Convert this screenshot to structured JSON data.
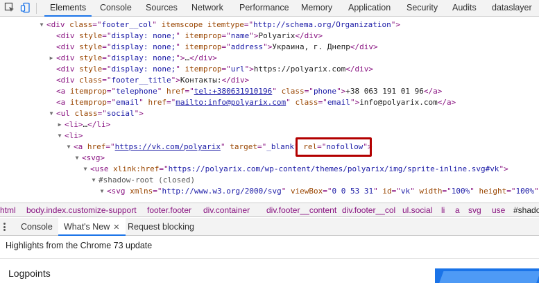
{
  "tabs": [
    "Elements",
    "Console",
    "Sources",
    "Network",
    "Performance",
    "Memory",
    "Application",
    "Security",
    "Audits",
    "dataslayer"
  ],
  "lines": [
    {
      "t": "open",
      "tag": "div",
      "attrs": [
        [
          "class",
          "footer__col"
        ],
        [
          "itemscope",
          null
        ],
        [
          "itemtype",
          "http://schema.org/Organization"
        ]
      ]
    },
    {
      "t": "div",
      "attrs": [
        [
          "style",
          "display: none;"
        ],
        [
          "itemprop",
          "name"
        ]
      ],
      "text": "Polyarix"
    },
    {
      "t": "div",
      "attrs": [
        [
          "style",
          "display: none;"
        ],
        [
          "itemprop",
          "address"
        ]
      ],
      "text": "Украина, г. Днепр"
    },
    {
      "t": "div",
      "attrs": [
        [
          "style",
          "display: none;"
        ]
      ],
      "text": "…"
    },
    {
      "t": "div",
      "attrs": [
        [
          "style",
          "display: none;"
        ],
        [
          "itemprop",
          "url"
        ]
      ],
      "text": "https://polyarix.com"
    },
    {
      "t": "div",
      "attrs": [
        [
          "class",
          "footer__title"
        ]
      ],
      "text": "Контакты:"
    },
    {
      "t": "a",
      "attrs": [
        [
          "itemprop",
          "telephone"
        ],
        [
          "href",
          "tel:+380631910196"
        ],
        [
          "class",
          "phone"
        ]
      ],
      "text": "+38 063 191 01 96"
    },
    {
      "t": "a",
      "attrs": [
        [
          "itemprop",
          "email"
        ],
        [
          "href",
          "mailto:info@polyarix.com"
        ],
        [
          "class",
          "email"
        ]
      ],
      "text": "info@polyarix.com"
    },
    {
      "t": "open",
      "tag": "ul",
      "attrs": [
        [
          "class",
          "social"
        ]
      ]
    },
    {
      "t": "li",
      "attrs": [],
      "text": "…"
    },
    {
      "t": "open",
      "tag": "li",
      "attrs": []
    },
    {
      "t": "open",
      "tag": "a",
      "attrs": [
        [
          "href",
          "https://vk.com/polyarix"
        ],
        [
          "target",
          "_blank"
        ],
        [
          "rel",
          "nofollow"
        ]
      ]
    },
    {
      "t": "open",
      "tag": "svg",
      "attrs": []
    },
    {
      "t": "open",
      "tag": "use",
      "attrs": [
        [
          "xlink:href",
          "https://polyarix.com/wp-content/themes/polyarix/img/sprite-inline.svg#vk"
        ]
      ]
    },
    {
      "t": "shadow",
      "text": "#shadow-root (closed)"
    },
    {
      "t": "open",
      "tag": "svg",
      "attrs": [
        [
          "xmlns",
          "http://www.w3.org/2000/svg"
        ],
        [
          "viewBox",
          "0 0 53 31"
        ],
        [
          "id",
          "vk"
        ],
        [
          "width",
          "100%"
        ],
        [
          "height",
          "100%"
        ]
      ]
    }
  ],
  "breadcrumbs": [
    "html",
    "body.index.customize-support",
    "footer.footer",
    "div.container",
    "div.footer__content",
    "div.footer__col",
    "ul.social",
    "li",
    "a",
    "svg",
    "use",
    "#shadow-root"
  ],
  "drawer_tabs": [
    "Console",
    "What's New",
    "Request blocking"
  ],
  "drawer_close": "✕",
  "headline": "Highlights from the Chrome 73 update",
  "subtitle": "Logpoints",
  "colors": {
    "accent": "#1a73e8",
    "tag": "#881280",
    "attr_name": "#994500",
    "attr_value": "#1a1aa6",
    "highlight": "#b30000"
  }
}
